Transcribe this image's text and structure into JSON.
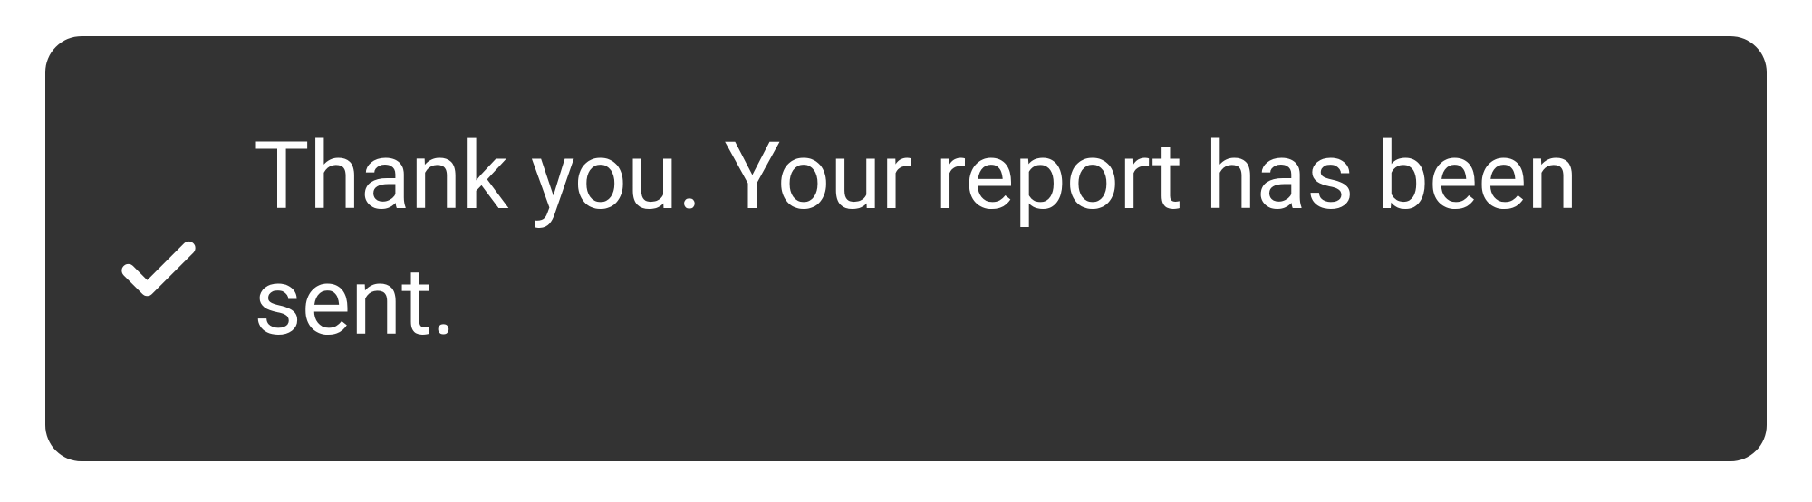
{
  "toast": {
    "message": "Thank you. Your report has been sent.",
    "icon": "check-icon",
    "background_color": "#333333",
    "text_color": "#ffffff"
  }
}
